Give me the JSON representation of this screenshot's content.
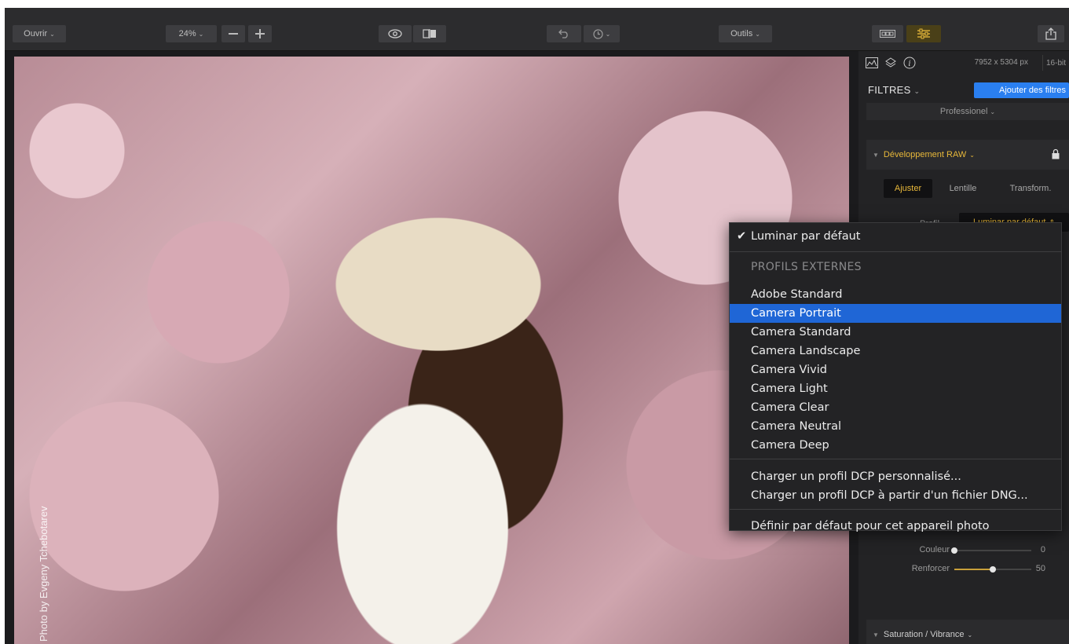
{
  "toolbar": {
    "open_label": "Ouvrir",
    "zoom_value": "24%",
    "tools_label": "Outils"
  },
  "photo": {
    "credit": "Photo by Evgeny Tchebotarev"
  },
  "panel": {
    "dimensions": "7952 x 5304 px",
    "bit_depth": "16-bit",
    "filters_label": "FILTRES",
    "add_filters_label": "Ajouter des filtres",
    "preset_label": "Professionel",
    "raw_section_label": "Développement RAW",
    "tabs": [
      {
        "label": "Ajuster"
      },
      {
        "label": "Lentille"
      },
      {
        "label": "Transform."
      }
    ],
    "profile_label": "Profil",
    "profile_value": "Luminar par défaut",
    "sliders": [
      {
        "label": "Couleur",
        "value": "0",
        "fraction": 0.0
      },
      {
        "label": "Renforcer",
        "value": "50",
        "fraction": 0.5
      }
    ],
    "saturation_section_label": "Saturation / Vibrance"
  },
  "menu": {
    "checked_item": "Luminar par défaut",
    "external_header": "PROFILS EXTERNES",
    "profiles": [
      "Adobe Standard",
      "Camera Portrait",
      "Camera Standard",
      "Camera Landscape",
      "Camera Vivid",
      "Camera Light",
      "Camera Clear",
      "Camera Neutral",
      "Camera Deep"
    ],
    "highlighted_profile": "Camera Portrait",
    "load_custom_dcp": "Charger un profil DCP personnalisé...",
    "load_dcp_from_dng": "Charger un profil DCP à partir d'un fichier DNG...",
    "set_default": "Définir par défaut pour cet appareil photo"
  },
  "colors": {
    "accent_gold": "#e8b83a",
    "highlight_blue": "#1f66d6",
    "button_blue": "#2a7ff0"
  }
}
